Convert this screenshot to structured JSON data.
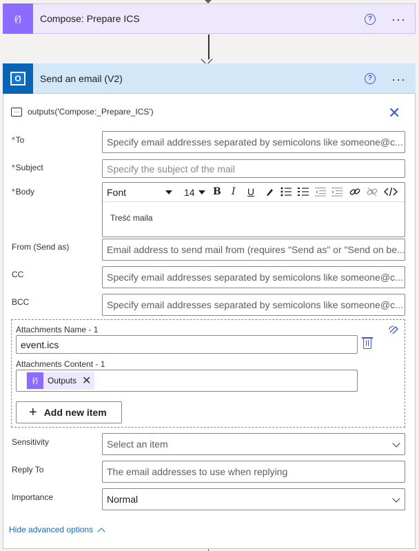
{
  "compose": {
    "icon": "compose-curly-braces-icon",
    "icon_glyph": "{⁄}",
    "title": "Compose: Prepare ICS",
    "accent": "#8c6cff"
  },
  "email_action": {
    "icon": "outlook-icon",
    "title": "Send an email (V2)",
    "accent": "#0a64b4",
    "outputs_ref": "outputs('Compose:_Prepare_ICS')",
    "fields": {
      "to": {
        "label": "To",
        "required": "*",
        "placeholder": "Specify email addresses separated by semicolons like someone@c..."
      },
      "subject": {
        "label": "Subject",
        "required": "*",
        "placeholder": "Specify the subject of the mail"
      },
      "body": {
        "label": "Body",
        "required": "*",
        "toolbar": {
          "font": "Font",
          "size": "14",
          "bold": "B",
          "italic": "I",
          "underline": "U"
        },
        "content": "Treść maila"
      },
      "from": {
        "label": "From (Send as)",
        "placeholder": "Email address to send mail from (requires \"Send as\" or \"Send on be..."
      },
      "cc": {
        "label": "CC",
        "placeholder": "Specify email addresses separated by semicolons like someone@c..."
      },
      "bcc": {
        "label": "BCC",
        "placeholder": "Specify email addresses separated by semicolons like someone@c..."
      }
    },
    "attachments": {
      "name_label": "Attachments Name - 1",
      "name_value": "event.ics",
      "content_label": "Attachments Content - 1",
      "content_token": "Outputs",
      "token_glyph": "{⁄}",
      "add_label": "Add new item",
      "add_glyph": "+"
    },
    "sensitivity": {
      "label": "Sensitivity",
      "value": "Select an item"
    },
    "reply_to": {
      "label": "Reply To",
      "placeholder": "The email addresses to use when replying"
    },
    "importance": {
      "label": "Importance",
      "value": "Normal"
    },
    "hide_advanced": "Hide advanced options"
  },
  "glyphs": {
    "help": "?",
    "more": "···",
    "close": "✕",
    "token_remove": "✕",
    "comment": "…"
  }
}
